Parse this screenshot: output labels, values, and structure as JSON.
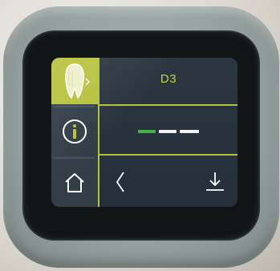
{
  "screen": {
    "title": "D3"
  },
  "nav": {
    "items": [
      {
        "name": "tooth",
        "icon": "tooth-icon",
        "active": true
      },
      {
        "name": "info",
        "icon": "info-icon",
        "active": false
      },
      {
        "name": "home",
        "icon": "home-icon",
        "active": false
      }
    ]
  },
  "indicator": {
    "segments": [
      {
        "color": "#3fb24a"
      },
      {
        "color": "#f2f2f2"
      },
      {
        "color": "#f2f2f2"
      }
    ]
  },
  "actions": {
    "back_icon": "chevron-left-icon",
    "save_icon": "download-icon"
  },
  "colors": {
    "accent": "#b7c23d",
    "background": "#2a3540",
    "green": "#3fb24a"
  }
}
